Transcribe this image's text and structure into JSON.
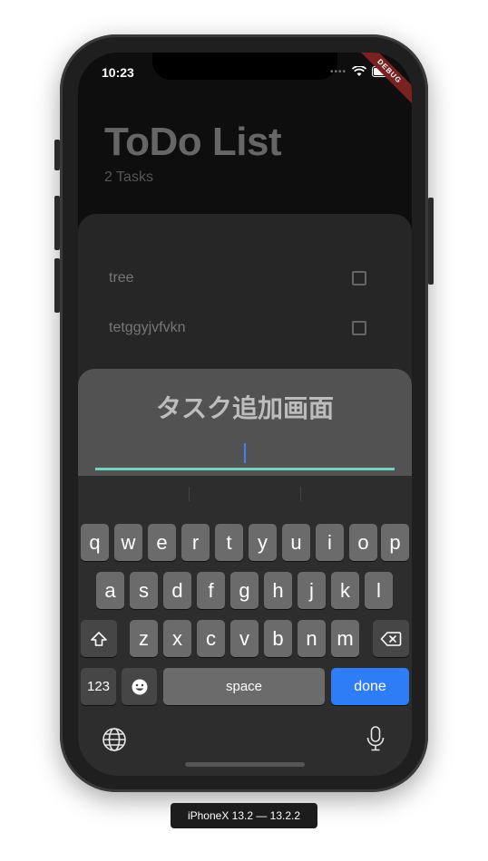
{
  "status_bar": {
    "time": "10:23",
    "debug_label": "DEBUG"
  },
  "app": {
    "title": "ToDo List",
    "subtitle": "2 Tasks"
  },
  "tasks": [
    {
      "label": "tree",
      "checked": false
    },
    {
      "label": "tetggyjvfvkn",
      "checked": false
    }
  ],
  "sheet": {
    "title": "タスク追加画面",
    "input_value": ""
  },
  "keyboard": {
    "row1": [
      "q",
      "w",
      "e",
      "r",
      "t",
      "y",
      "u",
      "i",
      "o",
      "p"
    ],
    "row2": [
      "a",
      "s",
      "d",
      "f",
      "g",
      "h",
      "j",
      "k",
      "l"
    ],
    "row3": [
      "z",
      "x",
      "c",
      "v",
      "b",
      "n",
      "m"
    ],
    "numbers_label": "123",
    "space_label": "space",
    "done_label": "done",
    "shift_icon": "shift-icon",
    "backspace_icon": "backspace-icon",
    "emoji_icon": "emoji-icon",
    "globe_icon": "globe-icon",
    "mic_icon": "microphone-icon"
  },
  "colors": {
    "accent_underline": "#6fd3c2",
    "done_key": "#2f7df6",
    "caret": "#3b82f6"
  },
  "device_label": "iPhoneX 13.2 — 13.2.2"
}
